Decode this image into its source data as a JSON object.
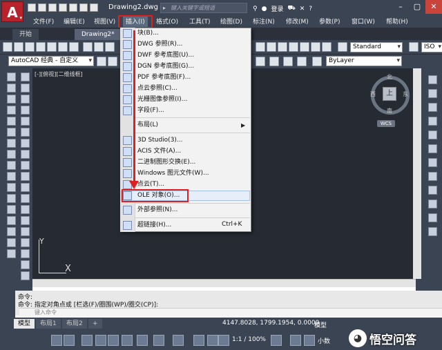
{
  "title_bar": {
    "document": "Drawing2.dwg",
    "search_placeholder": "键入关键字或短语",
    "login": "登录"
  },
  "menu": [
    "文件(F)",
    "编辑(E)",
    "视图(V)",
    "插入(I)",
    "格式(O)",
    "工具(T)",
    "绘图(D)",
    "标注(N)",
    "修改(M)",
    "参数(P)",
    "窗口(W)",
    "帮助(H)"
  ],
  "tabs": [
    "开始",
    "Drawing2*"
  ],
  "toolbar": {
    "text_style": "Standard",
    "iso": "ISO",
    "workspace": "AutoCAD 经典 - 自定义",
    "layer": "ByLayer"
  },
  "view_label": "[-][俯视][二维线框]",
  "viewcube": {
    "north": "北",
    "south": "南",
    "east": "东",
    "west": "西",
    "face": "上",
    "wcs": "WCS"
  },
  "ucs": {
    "x": "X",
    "y": "Y"
  },
  "insert_menu": {
    "items_a": [
      "块(B)...",
      "DWG 参照(R)...",
      "DWF 参考底图(U)...",
      "DGN 参考底图(G)...",
      "PDF 参考底图(F)...",
      "点云参照(C)...",
      "光栅图像参照(I)...",
      "字段(F)..."
    ],
    "layout": "布局(L)",
    "items_b": [
      "3D Studio(3)...",
      "ACIS 文件(A)...",
      "二进制图形交换(E)...",
      "Windows 图元文件(W)...",
      "点云(T)...",
      "OLE 对象(O)..."
    ],
    "xref": "外部参照(N)...",
    "hyperlink": "超链接(H)...",
    "hyperlink_shortcut": "Ctrl+K"
  },
  "command": {
    "line1": "命令:",
    "line2": "命令: 指定对角点或 [栏选(F)/圈围(WP)/圈交(CP)]:",
    "placeholder": "键入命令"
  },
  "layout_tabs": [
    "模型",
    "布局1",
    "布局2"
  ],
  "status": {
    "coords": "4147.8028, 1799.1954, 0.0000",
    "model": "模型",
    "scale": "1:1 / 100%",
    "units": "小数"
  },
  "watermark": "悟空问答"
}
